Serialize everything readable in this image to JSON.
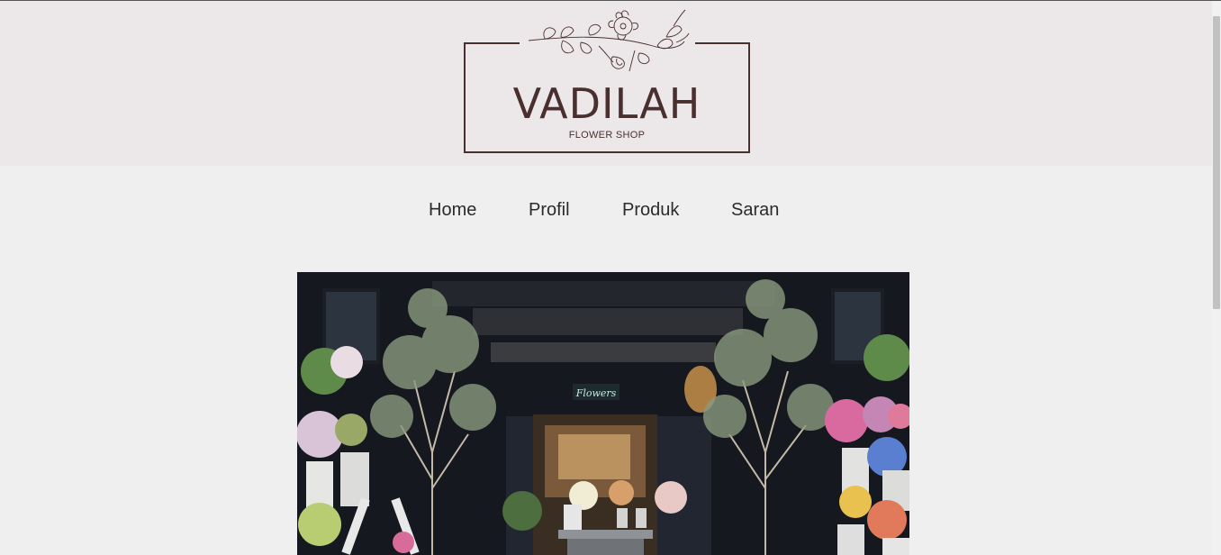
{
  "brand": {
    "name": "VADILAH",
    "tagline": "FLOWER SHOP",
    "color": "#4a2f2f"
  },
  "nav": {
    "items": [
      {
        "label": "Home"
      },
      {
        "label": "Profil"
      },
      {
        "label": "Produk"
      },
      {
        "label": "Saran"
      }
    ]
  },
  "hero": {
    "sign_text": "Flowers",
    "icon": "flower-shop-storefront-photo"
  },
  "colors": {
    "header_bg": "#ece8e9",
    "page_bg": "#f0efef",
    "nav_text": "#2b2b2b"
  }
}
